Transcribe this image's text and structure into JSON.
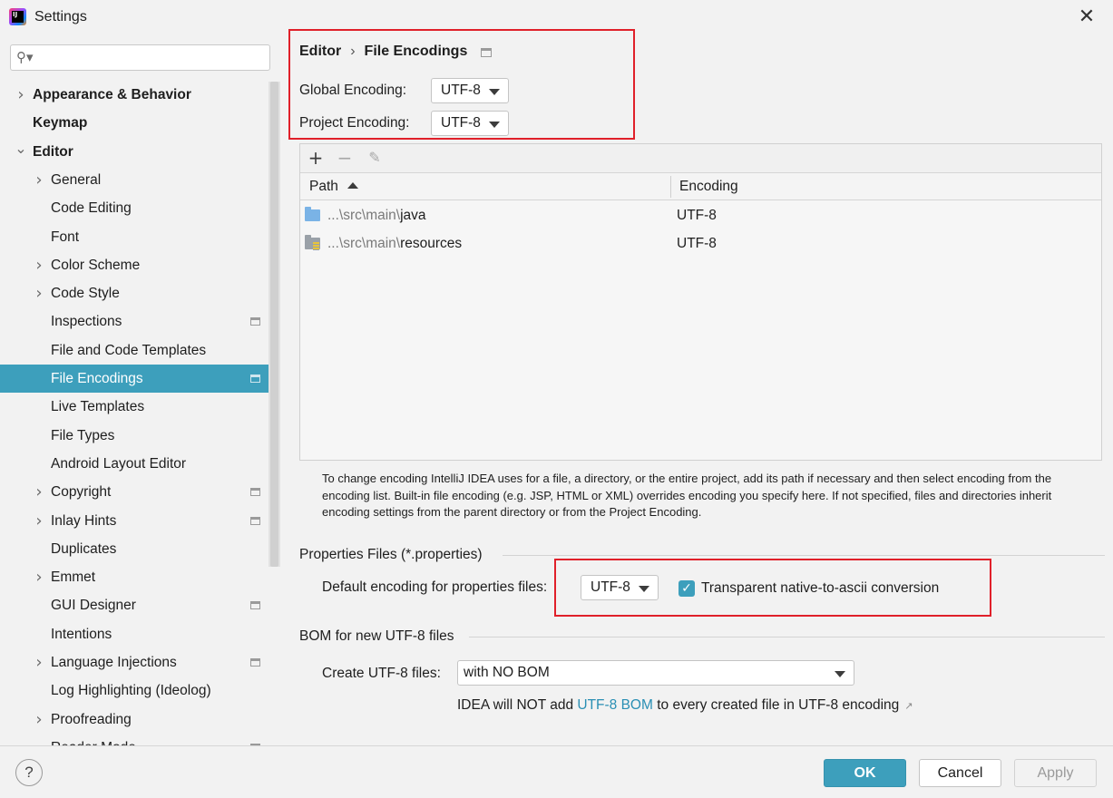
{
  "window": {
    "title": "Settings"
  },
  "search": {
    "placeholder": ""
  },
  "sidebar": {
    "items": [
      {
        "label": "Appearance & Behavior",
        "level": 0,
        "chevron": "right",
        "bold": true
      },
      {
        "label": "Keymap",
        "level": 0,
        "chevron": "",
        "bold": true
      },
      {
        "label": "Editor",
        "level": 0,
        "chevron": "down",
        "bold": true
      },
      {
        "label": "General",
        "level": 1,
        "chevron": "right"
      },
      {
        "label": "Code Editing",
        "level": 1,
        "chevron": ""
      },
      {
        "label": "Font",
        "level": 1,
        "chevron": ""
      },
      {
        "label": "Color Scheme",
        "level": 1,
        "chevron": "right"
      },
      {
        "label": "Code Style",
        "level": 1,
        "chevron": "right"
      },
      {
        "label": "Inspections",
        "level": 1,
        "chevron": "",
        "badge": true
      },
      {
        "label": "File and Code Templates",
        "level": 1,
        "chevron": ""
      },
      {
        "label": "File Encodings",
        "level": 1,
        "chevron": "",
        "badge": true,
        "selected": true
      },
      {
        "label": "Live Templates",
        "level": 1,
        "chevron": ""
      },
      {
        "label": "File Types",
        "level": 1,
        "chevron": ""
      },
      {
        "label": "Android Layout Editor",
        "level": 1,
        "chevron": ""
      },
      {
        "label": "Copyright",
        "level": 1,
        "chevron": "right",
        "badge": true
      },
      {
        "label": "Inlay Hints",
        "level": 1,
        "chevron": "right",
        "badge": true
      },
      {
        "label": "Duplicates",
        "level": 1,
        "chevron": ""
      },
      {
        "label": "Emmet",
        "level": 1,
        "chevron": "right"
      },
      {
        "label": "GUI Designer",
        "level": 1,
        "chevron": "",
        "badge": true
      },
      {
        "label": "Intentions",
        "level": 1,
        "chevron": ""
      },
      {
        "label": "Language Injections",
        "level": 1,
        "chevron": "right",
        "badge": true
      },
      {
        "label": "Log Highlighting (Ideolog)",
        "level": 1,
        "chevron": ""
      },
      {
        "label": "Proofreading",
        "level": 1,
        "chevron": "right"
      },
      {
        "label": "Reader Mode",
        "level": 1,
        "chevron": "",
        "badge": true
      }
    ]
  },
  "breadcrumb": {
    "parent": "Editor",
    "separator": "›",
    "current": "File Encodings"
  },
  "encodings": {
    "global_label": "Global Encoding:",
    "global_value": "UTF-8",
    "project_label": "Project Encoding:",
    "project_value": "UTF-8"
  },
  "table": {
    "columns": [
      "Path",
      "Encoding"
    ],
    "rows": [
      {
        "path_prefix": "...\\src\\main\\",
        "path_name": "java",
        "encoding": "UTF-8",
        "icon": "source-folder-icon"
      },
      {
        "path_prefix": "...\\src\\main\\",
        "path_name": "resources",
        "encoding": "UTF-8",
        "icon": "resources-folder-icon"
      }
    ]
  },
  "help_text": "To change encoding IntelliJ IDEA uses for a file, a directory, or the entire project, add its path if necessary and then select encoding from the encoding list. Built-in file encoding (e.g. JSP, HTML or XML) overrides encoding you specify here. If not specified, files and directories inherit encoding settings from the parent directory or from the Project Encoding.",
  "properties": {
    "section_title": "Properties Files (*.properties)",
    "default_label": "Default encoding for properties files:",
    "default_value": "UTF-8",
    "transparent_label": "Transparent native-to-ascii conversion",
    "transparent_checked": true
  },
  "bom": {
    "section_title": "BOM for new UTF-8 files",
    "create_label": "Create UTF-8 files:",
    "create_value": "with NO BOM",
    "note_prefix": "IDEA will NOT add ",
    "note_link": "UTF-8 BOM",
    "note_suffix": " to every created file in UTF-8 encoding",
    "note_arrow": "↗"
  },
  "footer": {
    "help": "?",
    "ok": "OK",
    "cancel": "Cancel",
    "apply": "Apply"
  },
  "colors": {
    "accent": "#3d9fbc",
    "highlight_box": "#e0202a",
    "link": "#2a8fb4"
  }
}
